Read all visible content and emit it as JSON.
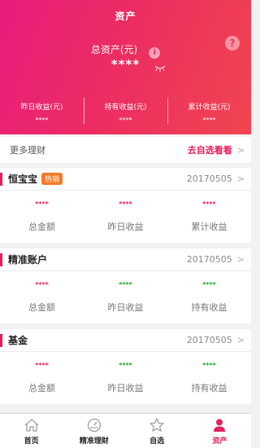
{
  "header": {
    "title": "资产",
    "help_icon": "?",
    "info_icon": "i",
    "total_label": "总资产(元)",
    "total_value": "****",
    "stats": [
      {
        "label": "昨日收益(元)",
        "value": "****"
      },
      {
        "label": "持有收益(元)",
        "value": "****"
      },
      {
        "label": "累计收益(元)",
        "value": "****"
      }
    ]
  },
  "more": {
    "label": "更多理财",
    "link": "去自选看看",
    "chevron": ">"
  },
  "products": [
    {
      "name": "恒宝宝",
      "badge": "热销",
      "date": "20170505",
      "chevron": ">",
      "cols": [
        {
          "value": "****",
          "label": "总金额",
          "color": "#e4205c"
        },
        {
          "value": "****",
          "label": "昨日收益",
          "color": "#e4205c"
        },
        {
          "value": "****",
          "label": "累计收益",
          "color": "#e4205c"
        }
      ]
    },
    {
      "name": "精准账户",
      "badge": "",
      "date": "20170505",
      "chevron": ">",
      "cols": [
        {
          "value": "****",
          "label": "总金额",
          "color": "#e4205c"
        },
        {
          "value": "****",
          "label": "昨日收益",
          "color": "#21a52b"
        },
        {
          "value": "****",
          "label": "持有收益",
          "color": "#21a52b"
        }
      ]
    },
    {
      "name": "基金",
      "badge": "",
      "date": "20170505",
      "chevron": ">",
      "cols": [
        {
          "value": "****",
          "label": "总金额",
          "color": "#e4205c"
        },
        {
          "value": "****",
          "label": "昨日收益",
          "color": "#21a52b"
        },
        {
          "value": "****",
          "label": "持有收益",
          "color": "#21a52b"
        }
      ]
    }
  ],
  "tabs": [
    {
      "label": "首页",
      "icon": "home-icon"
    },
    {
      "label": "精准理财",
      "icon": "gauge-icon"
    },
    {
      "label": "自选",
      "icon": "star-icon"
    },
    {
      "label": "资产",
      "icon": "user-icon",
      "active": true
    }
  ]
}
